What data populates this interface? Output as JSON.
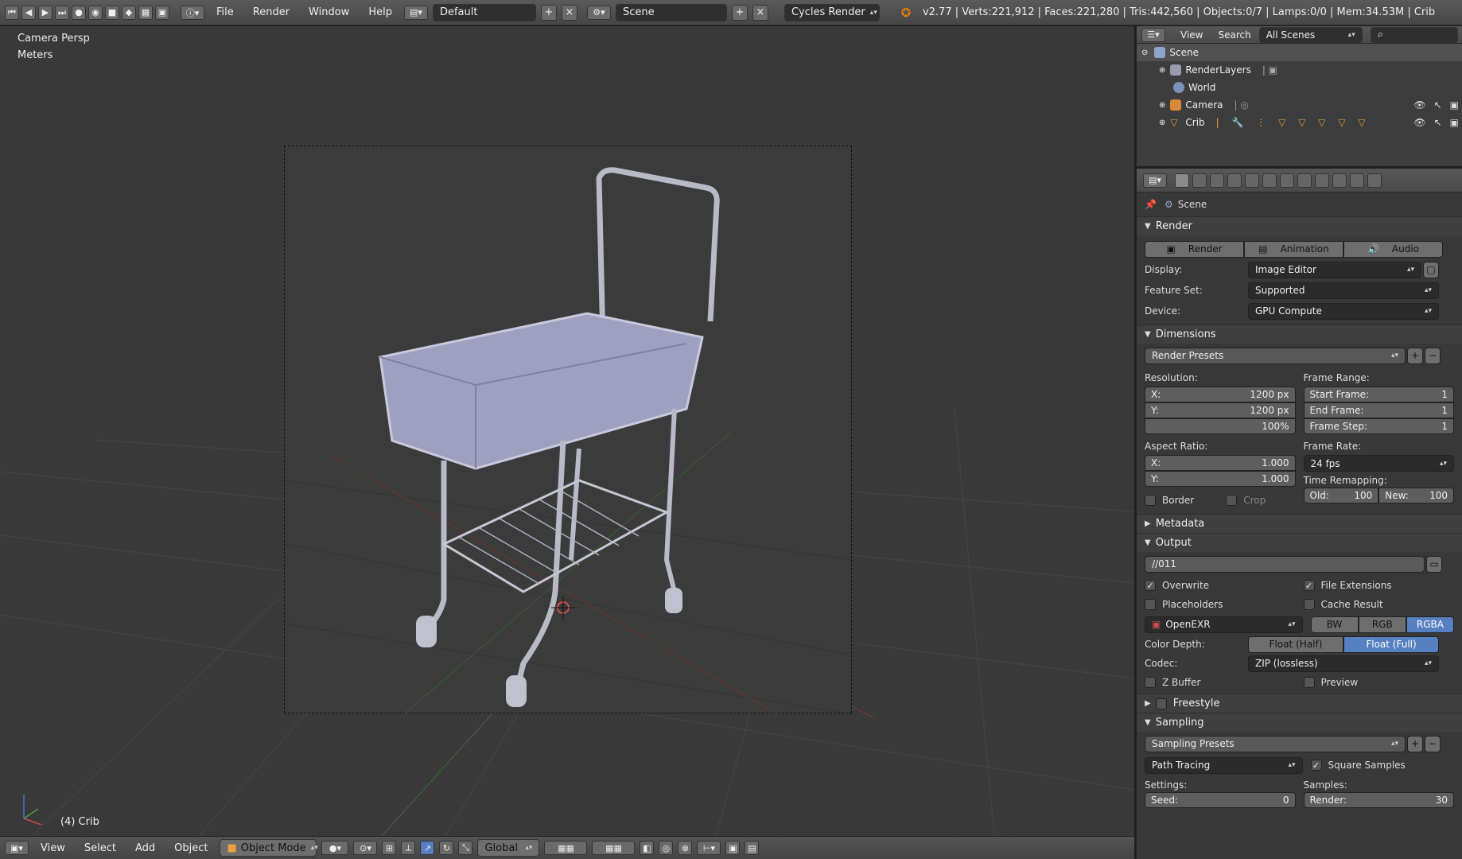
{
  "topbar": {
    "menus": [
      "File",
      "Render",
      "Window",
      "Help"
    ],
    "layout": "Default",
    "scene": "Scene",
    "engine": "Cycles Render",
    "stats": "v2.77 | Verts:221,912 | Faces:221,280 | Tris:442,560 | Objects:0/7 | Lamps:0/0 | Mem:34.53M | Crib"
  },
  "viewport": {
    "view_name": "Camera Persp",
    "units": "Meters",
    "object_label": "(4) Crib"
  },
  "bottombar": {
    "menus": [
      "View",
      "Select",
      "Add",
      "Object"
    ],
    "mode": "Object Mode",
    "orientation": "Global"
  },
  "outliner": {
    "menus": [
      "View",
      "Search"
    ],
    "filter": "All Scenes",
    "items": [
      "Scene",
      "RenderLayers",
      "World",
      "Camera",
      "Crib"
    ]
  },
  "props": {
    "context": "Scene",
    "render": {
      "title": "Render",
      "buttons": [
        "Render",
        "Animation",
        "Audio"
      ],
      "display_label": "Display:",
      "display": "Image Editor",
      "feature_label": "Feature Set:",
      "feature": "Supported",
      "device_label": "Device:",
      "device": "GPU Compute"
    },
    "dimensions": {
      "title": "Dimensions",
      "presets": "Render Presets",
      "resolution_label": "Resolution:",
      "res_x_label": "X:",
      "res_x": "1200 px",
      "res_y_label": "Y:",
      "res_y": "1200 px",
      "res_pct": "100%",
      "frame_range_label": "Frame Range:",
      "start_label": "Start Frame:",
      "start": "1",
      "end_label": "End Frame:",
      "end": "1",
      "step_label": "Frame Step:",
      "step": "1",
      "aspect_label": "Aspect Ratio:",
      "asp_x_label": "X:",
      "asp_x": "1.000",
      "asp_y_label": "Y:",
      "asp_y": "1.000",
      "frame_rate_label": "Frame Rate:",
      "frame_rate": "24 fps",
      "remap_label": "Time Remapping:",
      "old_label": "Old:",
      "old": "100",
      "new_label": "New:",
      "new": "100",
      "border": "Border",
      "crop": "Crop"
    },
    "metadata_title": "Metadata",
    "output": {
      "title": "Output",
      "path": "//011",
      "overwrite": "Overwrite",
      "file_ext": "File Extensions",
      "placeholders": "Placeholders",
      "cache": "Cache Result",
      "format": "OpenEXR",
      "channels": [
        "BW",
        "RGB",
        "RGBA"
      ],
      "depth_label": "Color Depth:",
      "depths": [
        "Float (Half)",
        "Float (Full)"
      ],
      "codec_label": "Codec:",
      "codec": "ZIP (lossless)",
      "zbuffer": "Z Buffer",
      "preview": "Preview"
    },
    "freestyle_title": "Freestyle",
    "sampling": {
      "title": "Sampling",
      "presets": "Sampling Presets",
      "integrator": "Path Tracing",
      "square": "Square Samples",
      "settings_label": "Settings:",
      "samples_label": "Samples:",
      "seed_label": "Seed:",
      "seed": "0",
      "render_label": "Render:",
      "render": "30"
    }
  },
  "colors": {
    "accent": "#5680c2",
    "viewport_bg": "#393939",
    "panel_bg": "#383838"
  }
}
